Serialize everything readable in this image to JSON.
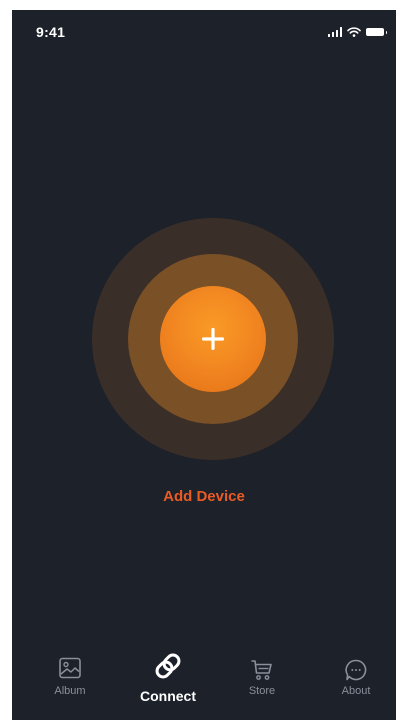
{
  "status_bar": {
    "time": "9:41",
    "icons": [
      "signal-icon",
      "wifi-icon",
      "battery-icon"
    ]
  },
  "main": {
    "add_device_icon": "plus-icon",
    "add_device_label": "Add Device"
  },
  "tab_bar": {
    "tabs": [
      {
        "label": "Album",
        "icon": "image-icon",
        "active": false
      },
      {
        "label": "Connect",
        "icon": "link-icon",
        "active": true
      },
      {
        "label": "Store",
        "icon": "cart-icon",
        "active": false
      },
      {
        "label": "About",
        "icon": "chat-bubble-icon",
        "active": false
      }
    ]
  },
  "colors": {
    "background": "#1d2129",
    "accent": "#f08420",
    "label_accent": "#ea5b24",
    "ring_outer": "#3a2e28",
    "ring_middle": "#7a5027",
    "tab_inactive": "#8a8f99",
    "tab_active": "#ffffff"
  }
}
